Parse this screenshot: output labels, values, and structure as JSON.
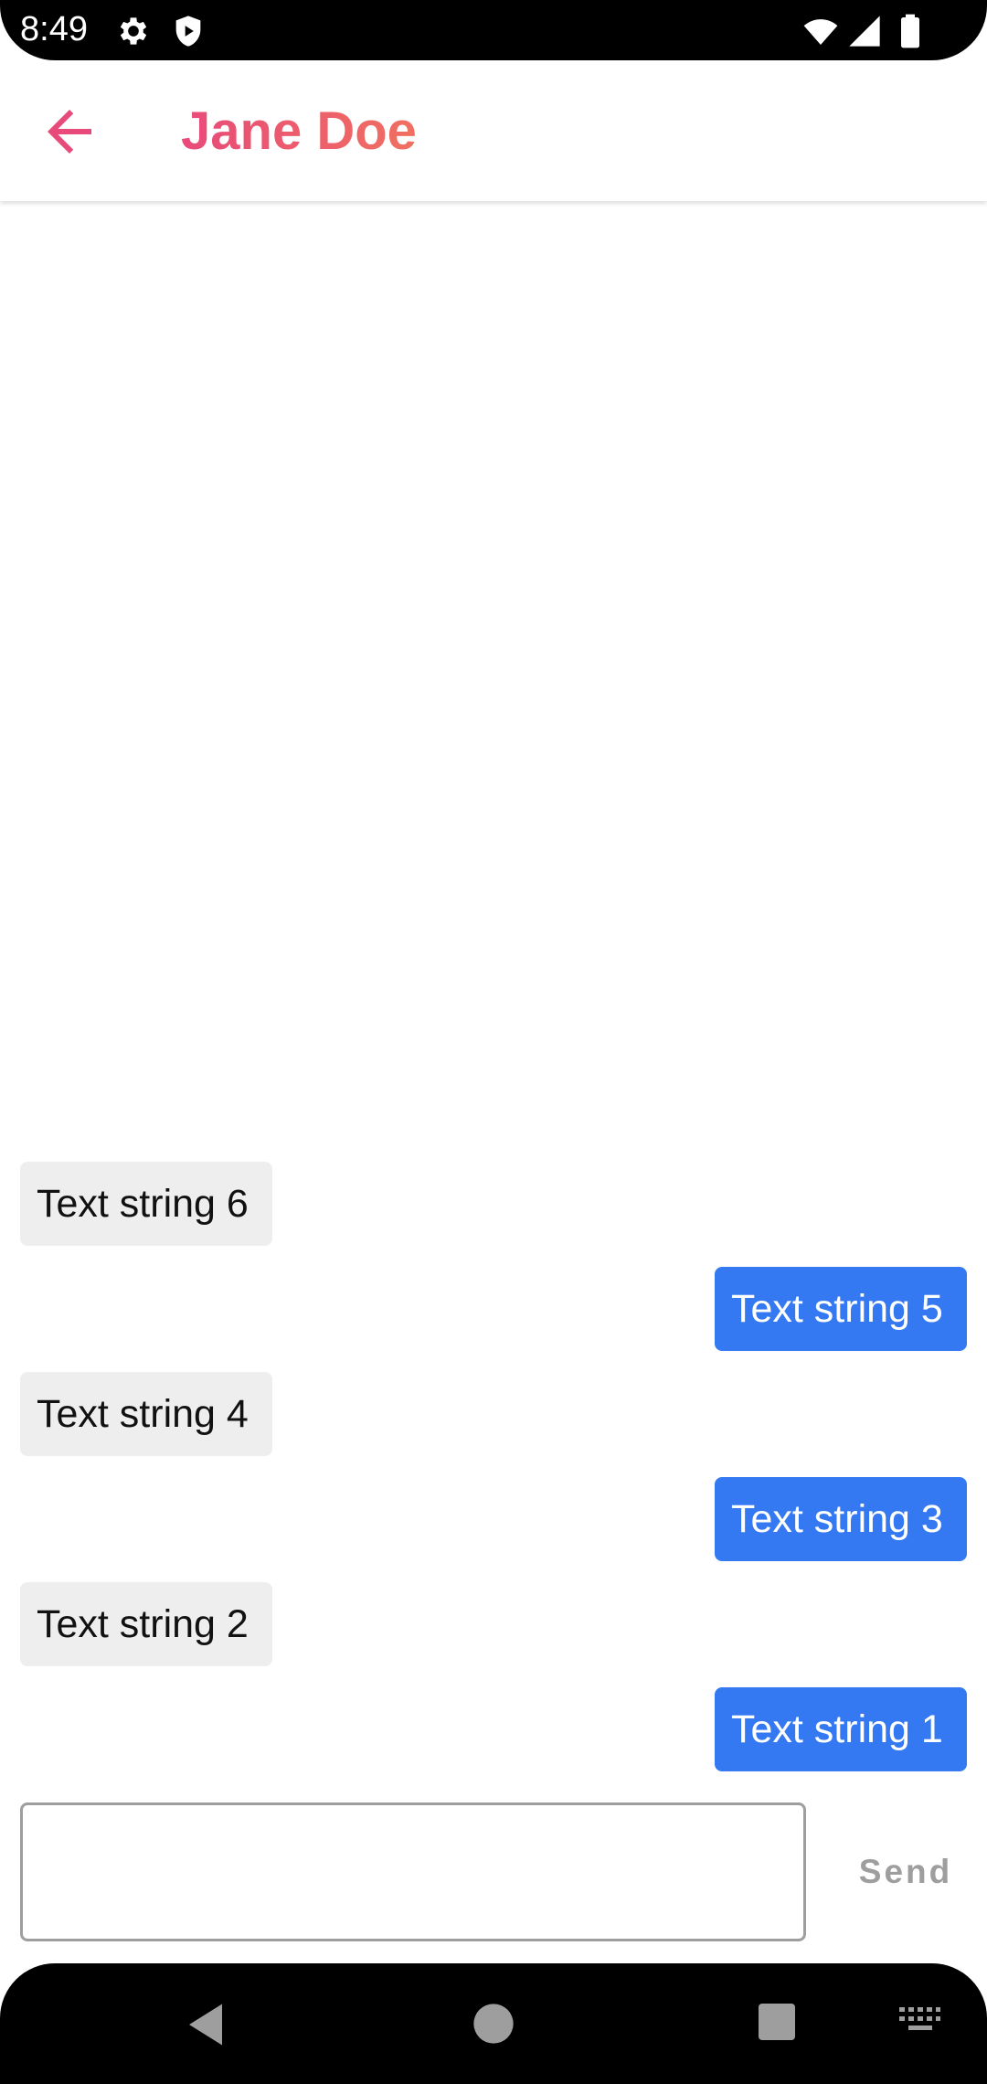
{
  "status_bar": {
    "time": "8:49",
    "icons": [
      "gear-icon",
      "shield-icon",
      "wifi-icon",
      "signal-icon",
      "battery-icon"
    ]
  },
  "app_bar": {
    "title": "Jane Doe",
    "back_icon": "arrow-left-icon",
    "accent_color": "#e84a7a"
  },
  "messages": [
    {
      "text": "Text string 6",
      "direction": "received"
    },
    {
      "text": "Text string 5",
      "direction": "sent"
    },
    {
      "text": "Text string 4",
      "direction": "received"
    },
    {
      "text": "Text string 3",
      "direction": "sent"
    },
    {
      "text": "Text string 2",
      "direction": "received"
    },
    {
      "text": "Text string 1",
      "direction": "sent"
    }
  ],
  "composer": {
    "value": "",
    "placeholder": "",
    "send_label": "Send"
  },
  "nav_bar": {
    "icons": [
      "back-triangle-icon",
      "home-circle-icon",
      "recents-square-icon",
      "keyboard-icon"
    ]
  },
  "colors": {
    "sent_bubble": "#3479f1",
    "received_bubble": "#eeeeee"
  }
}
